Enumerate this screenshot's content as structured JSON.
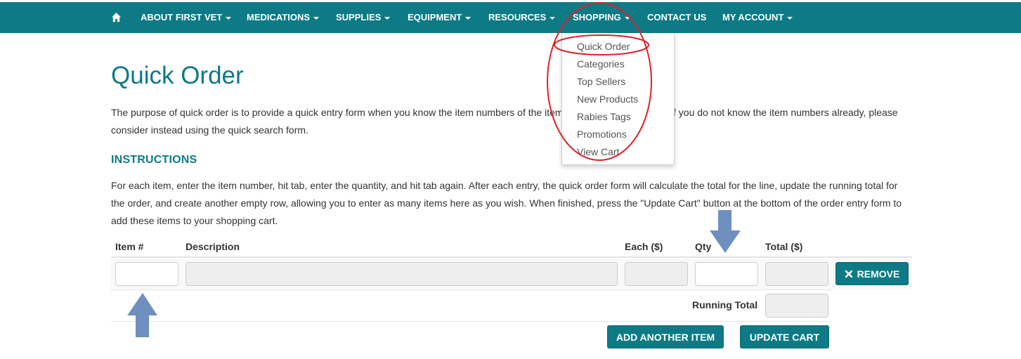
{
  "nav": {
    "home_icon": "home-icon",
    "items": [
      {
        "label": "ABOUT FIRST VET",
        "dropdown": true
      },
      {
        "label": "MEDICATIONS",
        "dropdown": true
      },
      {
        "label": "SUPPLIES",
        "dropdown": true
      },
      {
        "label": "EQUIPMENT",
        "dropdown": true
      },
      {
        "label": "RESOURCES",
        "dropdown": true
      },
      {
        "label": "SHOPPING",
        "dropdown": true
      },
      {
        "label": "CONTACT US",
        "dropdown": false
      },
      {
        "label": "MY ACCOUNT",
        "dropdown": true
      }
    ]
  },
  "shopping_menu": {
    "items": [
      "Quick Order",
      "Categories",
      "Top Sellers",
      "New Products",
      "Rabies Tags",
      "Promotions",
      "View Cart"
    ]
  },
  "page": {
    "title": "Quick Order",
    "intro_line1": "The purpose of quick order is to provide a quick entry form when you know the item numbers of the item",
    "intro_line1_right": "f you do not know the item numbers already, please",
    "intro_line2": "consider instead using the quick search form.",
    "instructions_heading": "INSTRUCTIONS",
    "instructions_line1": "For each item, enter the item number, hit tab, enter the quantity, and hit tab again. After each entry, the quick order form will calculate the total for the line, update the running total for",
    "instructions_line2": "the order, and create another empty row, allowing you to enter as many items here as you wish. When finished, press the \"Update Cart\" button at the bottom of the order entry form to",
    "instructions_line3": "add these items to your shopping cart."
  },
  "order_table": {
    "headers": {
      "item": "Item #",
      "description": "Description",
      "each": "Each ($)",
      "qty": "Qty",
      "total": "Total ($)"
    },
    "row": {
      "item": "",
      "description": "",
      "each": "",
      "qty": "",
      "total": ""
    },
    "remove_label": "REMOVE",
    "running_total_label": "Running Total",
    "running_total_value": ""
  },
  "actions": {
    "add_item_label": "ADD ANOTHER ITEM",
    "update_cart_label": "UPDATE CART"
  },
  "colors": {
    "brand": "#0d7a85",
    "annotation_red": "#e0202a",
    "annotation_arrow": "#6f8fc0"
  }
}
